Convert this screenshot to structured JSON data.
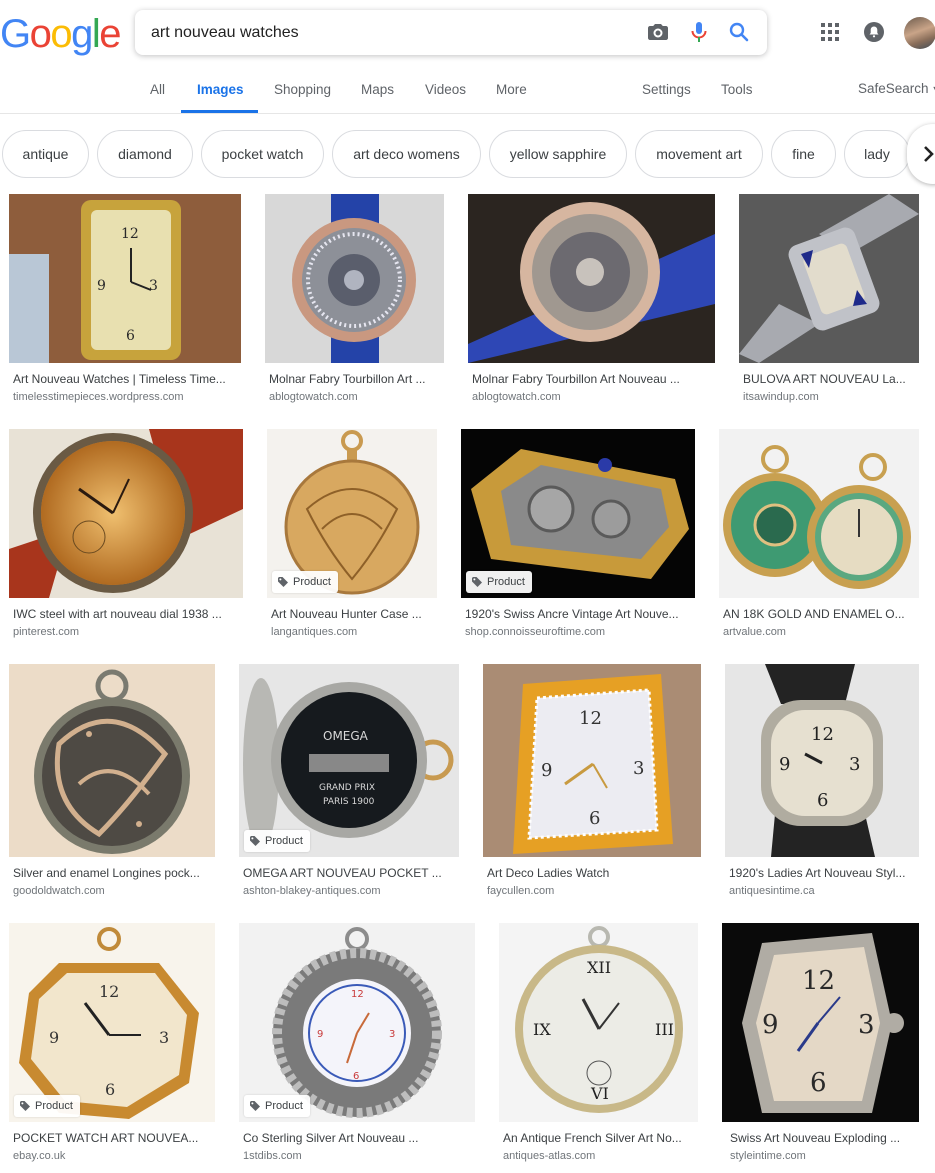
{
  "logo": {
    "letters": [
      "G",
      "o",
      "o",
      "g",
      "l",
      "e"
    ],
    "colors": [
      "#4285F4",
      "#EA4335",
      "#FBBC05",
      "#4285F4",
      "#34A853",
      "#EA4335"
    ]
  },
  "search": {
    "value": "art nouveau watches",
    "placeholder": ""
  },
  "icons": {
    "camera": "camera-icon",
    "mic": "mic-icon",
    "search": "search-icon",
    "apps": "apps-grid-icon",
    "notifications": "notifications-icon"
  },
  "tabs": {
    "all": "All",
    "images": "Images",
    "shopping": "Shopping",
    "maps": "Maps",
    "videos": "Videos",
    "more": "More",
    "settings": "Settings",
    "tools": "Tools",
    "safesearch": "SafeSearch"
  },
  "chips": [
    "antique",
    "diamond",
    "pocket watch",
    "art deco womens",
    "yellow sapphire",
    "movement art",
    "fine",
    "lady"
  ],
  "colors": {
    "accent": "#1a73e8",
    "text": "#3c4043",
    "muted": "#70757a"
  },
  "results": [
    {
      "title": "Art Nouveau Watches | Timeless Time...",
      "source": "timelesstimepieces.wordpress.com",
      "product": ""
    },
    {
      "title": "Molnar Fabry Tourbillon Art ...",
      "source": "ablogtowatch.com",
      "product": ""
    },
    {
      "title": "Molnar Fabry Tourbillon Art Nouveau ...",
      "source": "ablogtowatch.com",
      "product": ""
    },
    {
      "title": "BULOVA ART NOUVEAU La...",
      "source": "itsawindup.com",
      "product": ""
    },
    {
      "title": "IWC steel with art nouveau dial 1938 ...",
      "source": "pinterest.com",
      "product": ""
    },
    {
      "title": "Art Nouveau Hunter Case ...",
      "source": "langantiques.com",
      "product": "Product"
    },
    {
      "title": "1920's Swiss Ancre Vintage Art Nouve...",
      "source": "shop.connoisseuroftime.com",
      "product": "Product"
    },
    {
      "title": "AN 18K GOLD AND ENAMEL O...",
      "source": "artvalue.com",
      "product": ""
    },
    {
      "title": "Silver and enamel Longines pock...",
      "source": "goodoldwatch.com",
      "product": ""
    },
    {
      "title": "OMEGA ART NOUVEAU POCKET ...",
      "source": "ashton-blakey-antiques.com",
      "product": "Product"
    },
    {
      "title": "Art Deco Ladies Watch",
      "source": "faycullen.com",
      "product": ""
    },
    {
      "title": "1920's Ladies Art Nouveau Styl...",
      "source": "antiquesintime.ca",
      "product": ""
    },
    {
      "title": "POCKET WATCH ART NOUVEA...",
      "source": "ebay.co.uk",
      "product": "Product"
    },
    {
      "title": "Co Sterling Silver Art Nouveau ...",
      "source": "1stdibs.com",
      "product": "Product"
    },
    {
      "title": "An Antique French Silver Art No...",
      "source": "antiques-atlas.com",
      "product": ""
    },
    {
      "title": "Swiss Art Nouveau Exploding ...",
      "source": "styleintime.com",
      "product": ""
    }
  ]
}
